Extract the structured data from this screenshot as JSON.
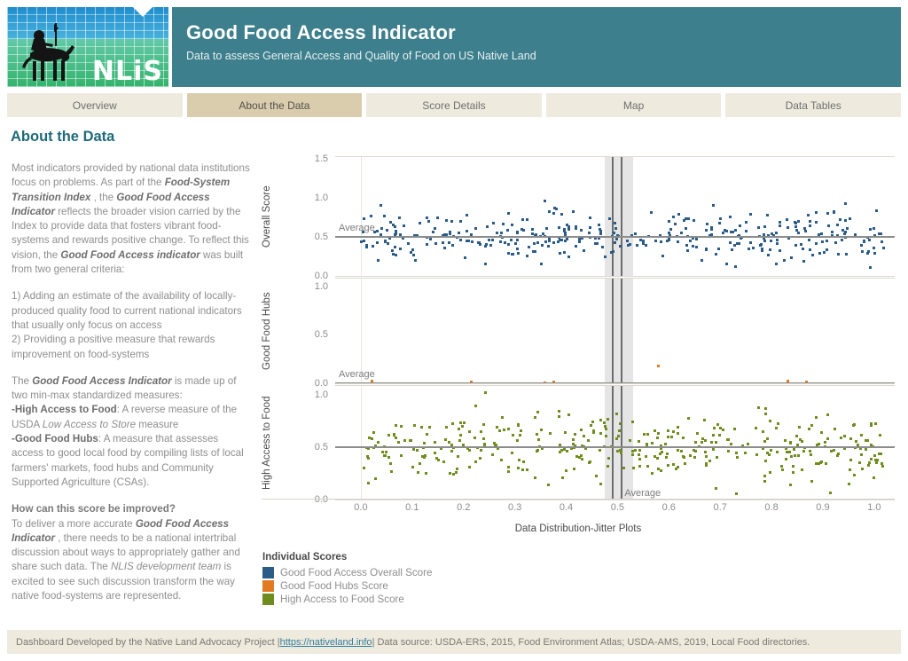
{
  "header": {
    "logo_alt": "NLIS logo - horse rider on wireframe landscape",
    "logo_wordmark": "NLiS",
    "title": "Good Food Access Indicator",
    "subtitle": "Data to assess General Access and Quality of Food on US Native Land",
    "bar_color": "#3d7f8c"
  },
  "tabs": [
    {
      "label": "Overview",
      "active": false
    },
    {
      "label": "About the Data",
      "active": true
    },
    {
      "label": "Score Details",
      "active": false
    },
    {
      "label": "Map",
      "active": false
    },
    {
      "label": "Data Tables",
      "active": false
    }
  ],
  "about": {
    "heading": "About the Data",
    "para1_a": "Most indicators provided by national data institutions focus on problems. As part of the ",
    "para1_b": "Food-System Transition Index",
    "para1_c": " , the ",
    "para1_d": "Good Food Access Indicator",
    "para1_e": " reflects the broader vision carried by the Index to provide data that fosters vibrant food-systems and rewards positive change. To reflect this vision, the ",
    "para1_f": "Good Food Access indicator",
    "para1_g": " was built from two general criteria:",
    "para2": "1) Adding an estimate of the availability of locally-produced quality food to current national indicators that usually only focus on access",
    "para3": "2) Providing a positive measure that rewards improvement on food-systems",
    "para4_a": "The ",
    "para4_b": "Good Food Access Indicator",
    "para4_c": " is made up of two min-max standardized measures:",
    "bullet1_label": "-High Access to Food",
    "bullet1_a": ": A reverse measure of the USDA ",
    "bullet1_b": "Low Access to Store",
    "bullet1_c": " measure",
    "bullet2_label": "-Good Food Hubs",
    "bullet2_a": ": A measure that assesses access to good local food by compiling lists of local farmers' markets, food hubs and Community Supported Agriculture (CSAs).",
    "question": "How can this score be improved?",
    "para5_a": "To deliver a more accurate ",
    "para5_b": "Good Food Access Indicator",
    "para5_c": " , there needs to be a national intertribal discussion about ways to appropriately gather and share such data. The ",
    "para5_d": "NLIS development team",
    "para5_e": " is excited to see such discussion transform the way native food-systems are represented."
  },
  "chart_data": {
    "type": "scatter",
    "title": "",
    "xlabel": "Data Distribution-Jitter Plots",
    "xlim": [
      -0.05,
      1.04
    ],
    "xticks": [
      "0.0",
      "0.1",
      "0.2",
      "0.3",
      "0.4",
      "0.5",
      "0.6",
      "0.7",
      "0.8",
      "0.9",
      "1.0"
    ],
    "xtick_values": [
      0.0,
      0.1,
      0.2,
      0.3,
      0.4,
      0.5,
      0.6,
      0.7,
      0.8,
      0.9,
      1.0
    ],
    "grid": false,
    "legend_position": "below-left",
    "highlight_band": {
      "from": 0.475,
      "to": 0.53,
      "marker_a": 0.489,
      "marker_b": 0.507
    },
    "panels": [
      {
        "name": "overall-score",
        "ylabel": "Overall Score",
        "ylim": [
          0.0,
          1.55
        ],
        "yticks": [
          "0.0",
          "0.5",
          "1.0",
          "1.5"
        ],
        "ytick_values": [
          0.0,
          0.5,
          1.0,
          1.5
        ],
        "color": "#2b5b87",
        "average": 0.52,
        "average_label": "Average",
        "n_points": 420
      },
      {
        "name": "good-food-hubs",
        "ylabel": "Good Food Hubs",
        "ylim": [
          0.0,
          1.1
        ],
        "yticks": [
          "0.0",
          "0.5",
          "1.0"
        ],
        "ytick_values": [
          0.0,
          0.5,
          1.0
        ],
        "color": "#e07b23",
        "average": 0.02,
        "average_label": "Average",
        "n_points": 420
      },
      {
        "name": "high-access-to-food",
        "ylabel": "High Access to Food",
        "ylim": [
          0.0,
          1.1
        ],
        "yticks": [
          "0.0",
          "0.5",
          "1.0"
        ],
        "ytick_values": [
          0.0,
          0.5,
          1.0
        ],
        "color": "#6f8c1e",
        "average": 0.52,
        "average_label": "Average",
        "n_points": 420
      }
    ]
  },
  "legend": {
    "title": "Individual Scores",
    "items": [
      {
        "label": "Good Food Access Overall Score",
        "color": "#2b5b87"
      },
      {
        "label": "Good Food Hubs Score",
        "color": "#e07b23"
      },
      {
        "label": "High Access to Food Score",
        "color": "#6f8c1e"
      }
    ]
  },
  "footer": {
    "before_link": "Dashboard Developed by the Native Land Advocacy Project | ",
    "link": "https://nativeland.info",
    "after_link": " | Data source: USDA-ERS, 2015, Food Environment Atlas; USDA-AMS, 2019, Local Food directories."
  }
}
